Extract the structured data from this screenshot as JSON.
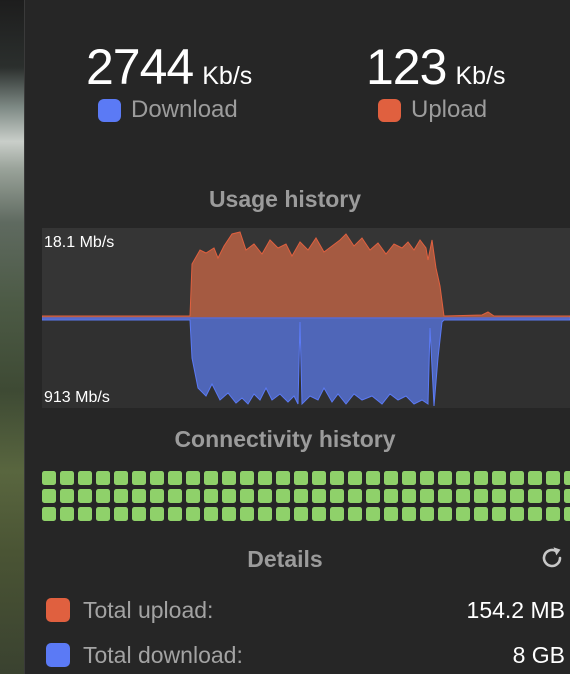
{
  "colors": {
    "download": "#5b7af5",
    "upload": "#e0603f",
    "connectivity_ok": "#8fd16a"
  },
  "current": {
    "download": {
      "value": "2744",
      "unit": "Kb/s",
      "label": "Download"
    },
    "upload": {
      "value": "123",
      "unit": "Kb/s",
      "label": "Upload"
    }
  },
  "usage_history": {
    "title": "Usage history",
    "upload_max_label": "18.1 Mb/s",
    "download_max_label": "913 Mb/s"
  },
  "connectivity_history": {
    "title": "Connectivity history",
    "rows": 3,
    "columns": 30,
    "all_connected": true
  },
  "details": {
    "title": "Details",
    "refresh_icon": "refresh-icon",
    "total_upload_label": "Total upload:",
    "total_upload_value": "154.2 MB",
    "total_download_label": "Total download:",
    "total_download_value": "8 GB"
  }
}
